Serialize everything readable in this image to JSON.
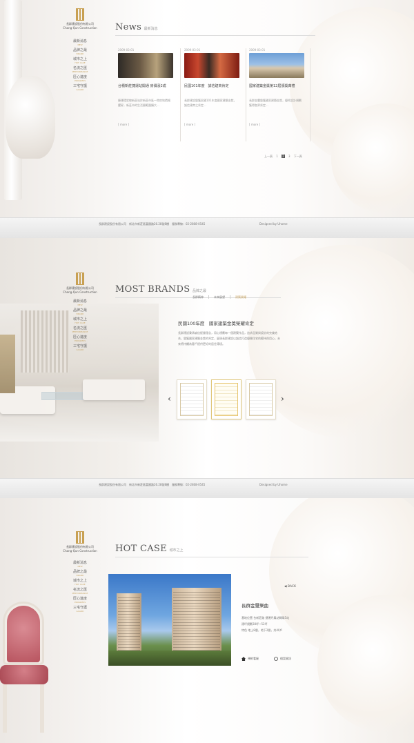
{
  "company": {
    "logo_cn": "長群建設股份有限公司",
    "logo_en": "Chang-Qun Construction"
  },
  "nav": [
    {
      "cn": "最新消息",
      "en": "NEW"
    },
    {
      "cn": "品牌之最",
      "en": "BRAND"
    },
    {
      "cn": "城市之上",
      "en": "HOT CASE"
    },
    {
      "cn": "名流之匯",
      "en": "PERFORMANCE"
    },
    {
      "cn": "匠心進度",
      "en": "PROGRESS"
    },
    {
      "cn": "三宅守護",
      "en": "GUARD"
    }
  ],
  "news": {
    "title": "News",
    "subtitle": "最新消息",
    "items": [
      {
        "date": "2009-03-01",
        "title": "台積新莊捷運站開通 房價漲2成",
        "desc": "捷運環狀線新莊站於新莊市區一帶房地價格躍昇，新莊市的生活圈範圍擴大...",
        "more": "[ more ]"
      },
      {
        "date": "2009-03-01",
        "title": "民國101年度　誠信建商肯定",
        "desc": "長群建設榮獲民國101年度國家建築金獎，誠信建商之肯定...",
        "more": "[ more ]"
      },
      {
        "date": "2009-03-01",
        "title": "國家建築金獎第12屆頒獎典禮",
        "desc": "長群金璽榮獲國家建築金獎，優秀設計規劃獲得各界肯定...",
        "more": "[ more ]"
      }
    ],
    "pager": {
      "prev": "上一頁",
      "pages": [
        "1",
        "2",
        "3"
      ],
      "current": "2",
      "next": "下一頁"
    }
  },
  "footer": {
    "text": "長群建設股份有限公司　新北市新莊區富國路26.28號8樓　服務專線：02-2808-0545",
    "designer": "Designed by Uhome"
  },
  "brands": {
    "title": "MOST BRANDS",
    "subtitle": "品牌之最",
    "tabs": [
      "長群精神",
      "未來展望",
      "建築榮耀"
    ],
    "active_tab": "建築榮耀",
    "heading": "民國100年度　國家建築金獎榮耀肯定",
    "desc": "長群建設秉承誠信經營理念，用心規劃每一個建築作品，追求品質與設計的完美結合，榮獲國家建築金獎的肯定，展現長群建設以誠信打造優質住宅的堅持與用心，未來將持續為客戶提供更好的居住環境。"
  },
  "hotcase": {
    "title": "HOT CASE",
    "subtitle": "城市之上",
    "back": "BACK",
    "name": "長群金璽樂曲",
    "info": [
      "基地位置 台新莊路 捷運丹鳳站轉乘5站",
      "建坪規劃38坪~52坪",
      "特色 地上8層，地下2層，共40戶"
    ],
    "links": [
      "預約看屋",
      "個案資訊"
    ]
  },
  "colors": {
    "accent_gold": "#c9a86a",
    "text_dark": "#444444",
    "text_light": "#999999"
  }
}
